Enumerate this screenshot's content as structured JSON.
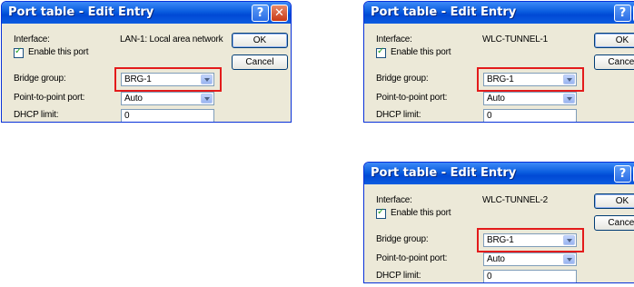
{
  "colors": {
    "highlight": "#e31b1b",
    "titlebar": "#0a5ddf",
    "dialog_bg": "#ece9d8"
  },
  "dialogs": [
    {
      "title": "Port table - Edit Entry",
      "interface_label": "Interface:",
      "interface_value": "LAN-1: Local area network",
      "enable_label": "Enable this port",
      "bridge_label": "Bridge group:",
      "bridge_value": "BRG-1",
      "p2p_label": "Point-to-point port:",
      "p2p_value": "Auto",
      "dhcp_label": "DHCP limit:",
      "dhcp_value": "0",
      "ok_label": "OK",
      "cancel_label": "Cancel",
      "help_icon": "?",
      "close_icon": "✕"
    },
    {
      "title": "Port table - Edit Entry",
      "interface_label": "Interface:",
      "interface_value": "WLC-TUNNEL-1",
      "enable_label": "Enable this port",
      "bridge_label": "Bridge group:",
      "bridge_value": "BRG-1",
      "p2p_label": "Point-to-point port:",
      "p2p_value": "Auto",
      "dhcp_label": "DHCP limit:",
      "dhcp_value": "0",
      "ok_label": "OK",
      "cancel_label": "Cancel",
      "help_icon": "?",
      "close_icon": "✕"
    },
    {
      "title": "Port table - Edit Entry",
      "interface_label": "Interface:",
      "interface_value": "WLC-TUNNEL-2",
      "enable_label": "Enable this port",
      "bridge_label": "Bridge group:",
      "bridge_value": "BRG-1",
      "p2p_label": "Point-to-point port:",
      "p2p_value": "Auto",
      "dhcp_label": "DHCP limit:",
      "dhcp_value": "0",
      "ok_label": "OK",
      "cancel_label": "Cancel",
      "help_icon": "?",
      "close_icon": "✕"
    }
  ]
}
